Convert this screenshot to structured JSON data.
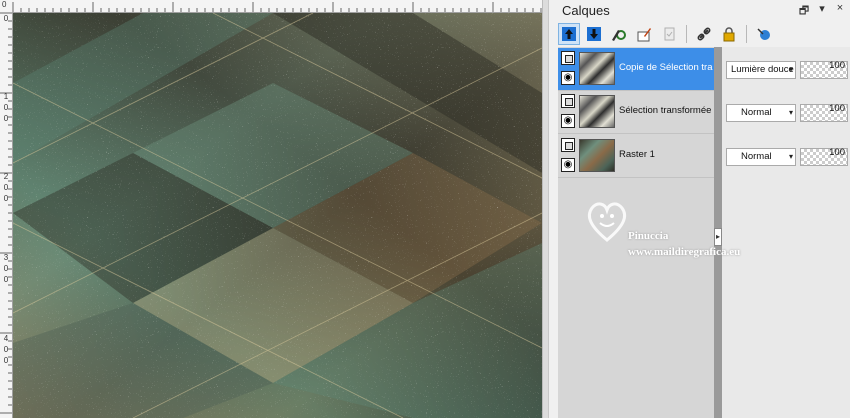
{
  "palette": {
    "title": "Calques",
    "controls": {
      "restore": "🗗",
      "menu": "▾",
      "close": "×"
    },
    "toolbar": [
      {
        "name": "new-raster-layer-icon",
        "glyph": "⬆"
      },
      {
        "name": "new-vector-layer-icon",
        "glyph": "⬇"
      },
      {
        "name": "layer-properties-icon",
        "glyph": "✎"
      },
      {
        "name": "brush-layer-icon",
        "glyph": "🖌"
      },
      {
        "name": "delete-layer-icon",
        "glyph": "🗑"
      },
      {
        "name": "link-layer-icon",
        "glyph": "🔗"
      },
      {
        "name": "lock-layer-icon",
        "glyph": "🔒"
      },
      {
        "name": "mask-layer-icon",
        "glyph": "⭮"
      }
    ]
  },
  "layers": [
    {
      "name": "Copie de Sélection tran",
      "blend": "Lumière douce",
      "opacity": "100",
      "selected": true
    },
    {
      "name": "Sélection transformée",
      "blend": "Normal",
      "opacity": "100",
      "selected": false
    },
    {
      "name": "Raster 1",
      "blend": "Normal",
      "opacity": "100",
      "selected": false
    }
  ],
  "rulers": {
    "left_labels": [
      "0",
      "1",
      "0",
      "0",
      "2",
      "0",
      "0",
      "3",
      "0",
      "0",
      "4",
      "0",
      "0"
    ]
  },
  "watermark": {
    "name": "Pinuccia",
    "url": "www.maildiregrafica.eu"
  },
  "colors": {
    "selection": "#3d8ee8",
    "canvas_dark": "#3b3a2f",
    "canvas_teal": "#5f8a79",
    "canvas_tan": "#8a7d5a"
  }
}
